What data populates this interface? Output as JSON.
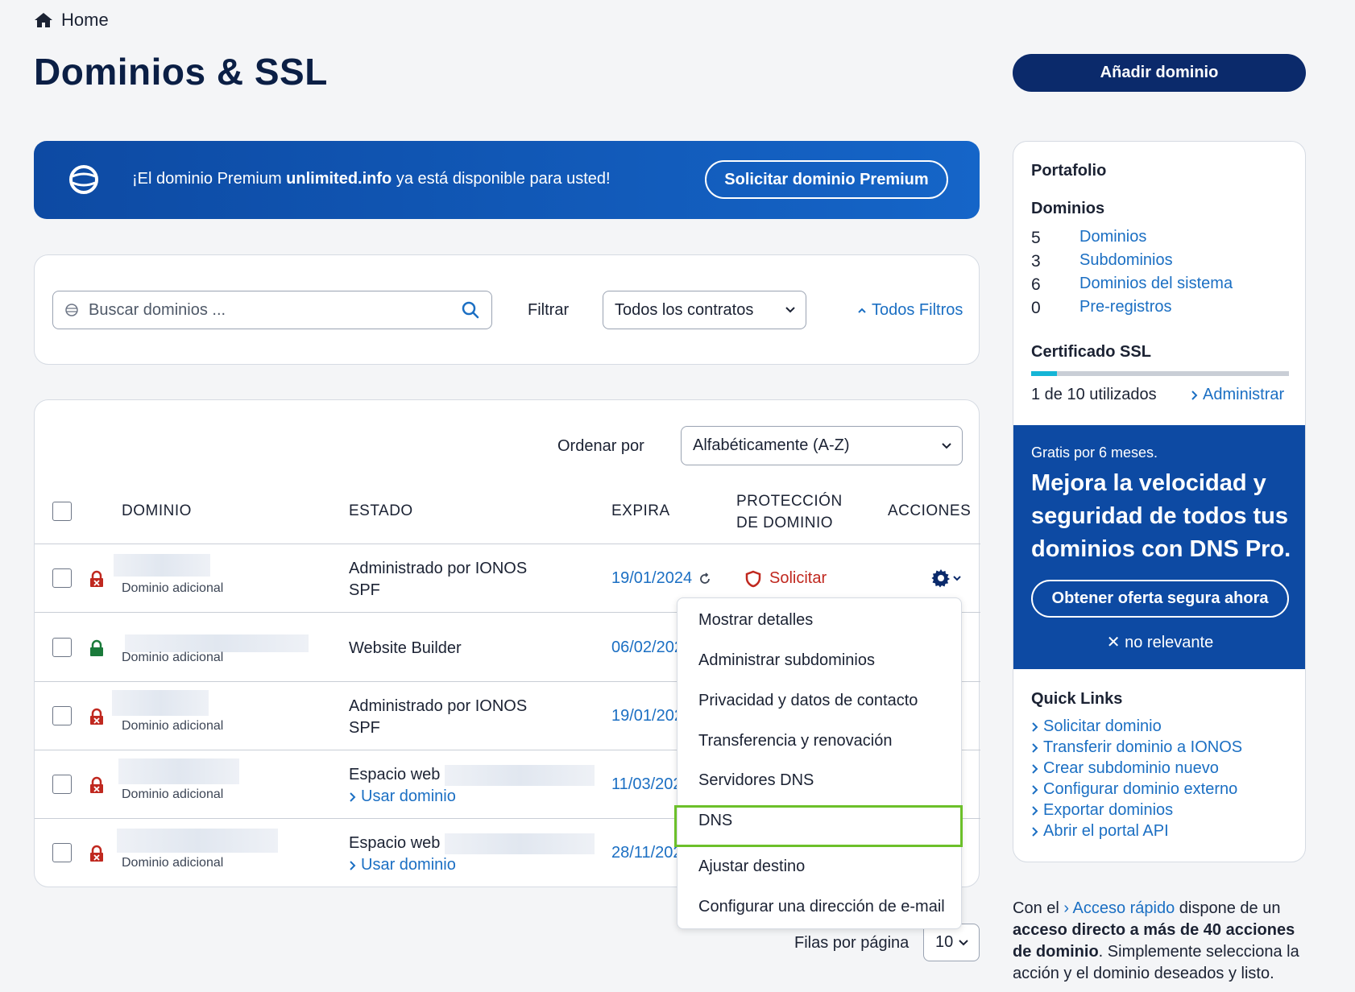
{
  "breadcrumb": {
    "home_label": "Home"
  },
  "page": {
    "title": "Dominios & SSL",
    "add_button": "Añadir dominio"
  },
  "promo": {
    "text_before": "¡El dominio Premium ",
    "domain": "unlimited.info",
    "text_after": " ya está disponible para usted!",
    "button": "Solicitar dominio Premium"
  },
  "search": {
    "placeholder": "Buscar dominios ...",
    "filter_label": "Filtrar",
    "contracts_value": "Todos los contratos",
    "all_filters": "Todos Filtros"
  },
  "table": {
    "sort_label": "Ordenar por",
    "sort_value": "Alfabéticamente (A-Z)",
    "headers": {
      "domain": "DOMINIO",
      "status": "ESTADO",
      "expires": "EXPIRA",
      "protection_line1": "PROTECCIÓN",
      "protection_line2": "DE DOMINIO",
      "actions": "ACCIONES"
    },
    "rows": [
      {
        "sub": "Dominio adicional",
        "status_line1": "Administrado por IONOS",
        "status_line2": "SPF",
        "expires": "19/01/2024",
        "protection": "Solicitar",
        "lock": "red"
      },
      {
        "sub": "Dominio adicional",
        "status_line1": "Website Builder",
        "status_line2": "",
        "expires": "06/02/202",
        "lock": "green"
      },
      {
        "sub": "Dominio adicional",
        "status_line1": "Administrado por IONOS",
        "status_line2": "SPF",
        "expires": "19/01/202",
        "lock": "red"
      },
      {
        "sub": "Dominio adicional",
        "status_line1": "Espacio web",
        "use_domain": "Usar dominio",
        "expires": "11/03/202",
        "lock": "red"
      },
      {
        "sub": "Dominio adicional",
        "status_line1": "Espacio web",
        "use_domain": "Usar dominio",
        "expires": "28/11/202",
        "lock": "red"
      }
    ],
    "rows_per_page_label": "Filas por página",
    "rows_per_page_value": "10"
  },
  "actions_menu": {
    "items": [
      "Mostrar detalles",
      "Administrar subdominios",
      "Privacidad y datos de contacto",
      "Transferencia y renovación",
      "Servidores DNS",
      "DNS",
      "Ajustar destino",
      "Configurar una dirección de e-mail"
    ],
    "highlighted": "DNS"
  },
  "portfolio": {
    "title": "Portafolio",
    "domains_heading": "Dominios",
    "counts": [
      {
        "count": "5",
        "label": "Dominios"
      },
      {
        "count": "3",
        "label": "Subdominios"
      },
      {
        "count": "6",
        "label": "Dominios del sistema"
      },
      {
        "count": "0",
        "label": "Pre-registros"
      }
    ],
    "ssl_heading": "Certificado SSL",
    "ssl_used": "1 de 10 utilizados",
    "ssl_used_fraction": 0.1,
    "ssl_admin": "Administrar"
  },
  "dns_promo": {
    "small": "Gratis por 6 meses.",
    "headline": "Mejora la velocidad y seguridad de todos tus dominios con DNS Pro.",
    "button": "Obtener oferta segura ahora",
    "dismiss": "no relevante"
  },
  "quick_links": {
    "title": "Quick Links",
    "items": [
      "Solicitar dominio",
      "Transferir dominio a IONOS",
      "Crear subdominio nuevo",
      "Configurar dominio externo",
      "Exportar dominios",
      "Abrir el portal API"
    ]
  },
  "bottom_note": {
    "before": "Con el ",
    "link": "Acceso rápido",
    "middle": " dispone de un ",
    "bold": "acceso directo a más de 40 acciones de dominio",
    "after": ". Simplemente selecciona la acción y el dominio deseados y listo."
  },
  "colors": {
    "navy": "#0b2a6b",
    "blue": "#0d4aa3",
    "link": "#1b6fc3",
    "danger": "#c0281f",
    "success": "#1a7a3a",
    "highlight": "#6cc02a",
    "ssl_fill": "#15b5d6"
  }
}
